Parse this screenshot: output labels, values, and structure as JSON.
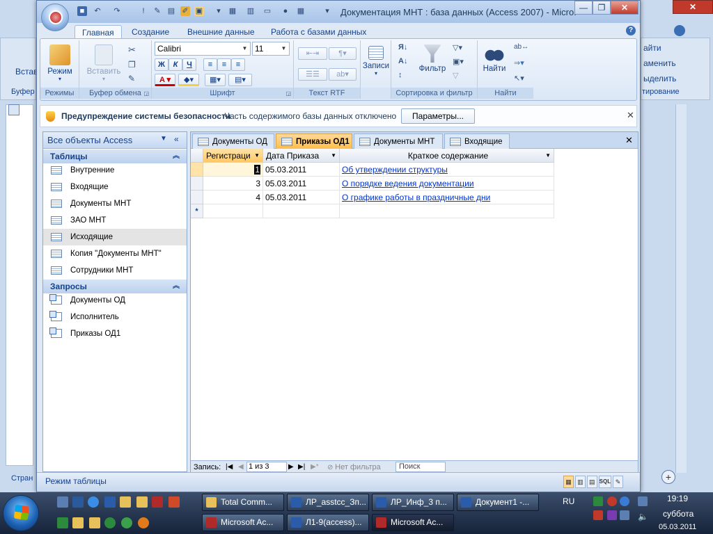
{
  "background_window": {
    "left_ribbon_fragment": "Встав",
    "left_group_fragment": "Буфер",
    "left_status_fragment": "Стран",
    "right_ribbon_items": [
      "айти",
      "аменить",
      "ыделить"
    ],
    "right_group_fragment": "тирование"
  },
  "title": "Документация МНТ : база данных (Access 2007) - Micro...",
  "ribbon_tabs": [
    "Главная",
    "Создание",
    "Внешние данные",
    "Работа с базами данных"
  ],
  "ribbon": {
    "groups": {
      "modes": "Режимы",
      "clipboard": "Буфер обмена",
      "font": "Шрифт",
      "rtf": "Текст RTF",
      "records": "Записи",
      "sort_filter": "Сортировка и фильтр",
      "find": "Найти"
    },
    "mode_label": "Режим",
    "paste_label": "Вставить",
    "records_label": "Записи",
    "filter_label": "Фильтр",
    "find_label": "Найти",
    "font_name": "Calibri",
    "font_size": "11",
    "bold": "Ж",
    "italic": "К",
    "underline": "Ч",
    "font_color": "A"
  },
  "security_bar": {
    "title": "Предупреждение системы безопасности",
    "message": "Часть содержимого базы данных отключено",
    "button": "Параметры..."
  },
  "nav_pane": {
    "header": "Все объекты Access",
    "tables_header": "Таблицы",
    "tables": [
      "Внутренние",
      "Входящие",
      "Документы МНТ",
      "ЗАО МНТ",
      "Исходящие",
      "Копия \"Документы МНТ\"",
      "Сотрудники МНТ"
    ],
    "queries_header": "Запросы",
    "queries": [
      "Документы ОД",
      "Исполнитель",
      "Приказы ОД1"
    ]
  },
  "doc_tabs": [
    "Документы ОД",
    "Приказы ОД1",
    "Документы МНТ",
    "Входящие"
  ],
  "grid": {
    "columns": [
      "Регистраци",
      "Дата Приказа",
      "Краткое содержание"
    ],
    "rows": [
      {
        "id": "1",
        "date": "05.03.2011",
        "summary": "Об утверждении структуры"
      },
      {
        "id": "3",
        "date": "05.03.2011",
        "summary": "О порядке ведения документации"
      },
      {
        "id": "4",
        "date": "05.03.2011",
        "summary": "О графике работы в праздничные дни"
      }
    ],
    "new_row_marker": "*"
  },
  "record_nav": {
    "label": "Запись:",
    "position": "1 из 3",
    "filter": "Нет фильтра",
    "search": "Поиск"
  },
  "status_bar": {
    "text": "Режим таблицы",
    "sql": "SQL"
  },
  "taskbar": {
    "row1": [
      "Total Comm...",
      "ЛР_asstcc_Зп...",
      "ЛР_Инф_3 п...",
      "Документ1 -..."
    ],
    "row2": [
      "Microsoft Ac...",
      "Л1-9(access)...",
      "Microsoft Ac..."
    ],
    "lang": "RU",
    "time": "19:19",
    "day": "суббота",
    "date": "05.03.2011"
  }
}
